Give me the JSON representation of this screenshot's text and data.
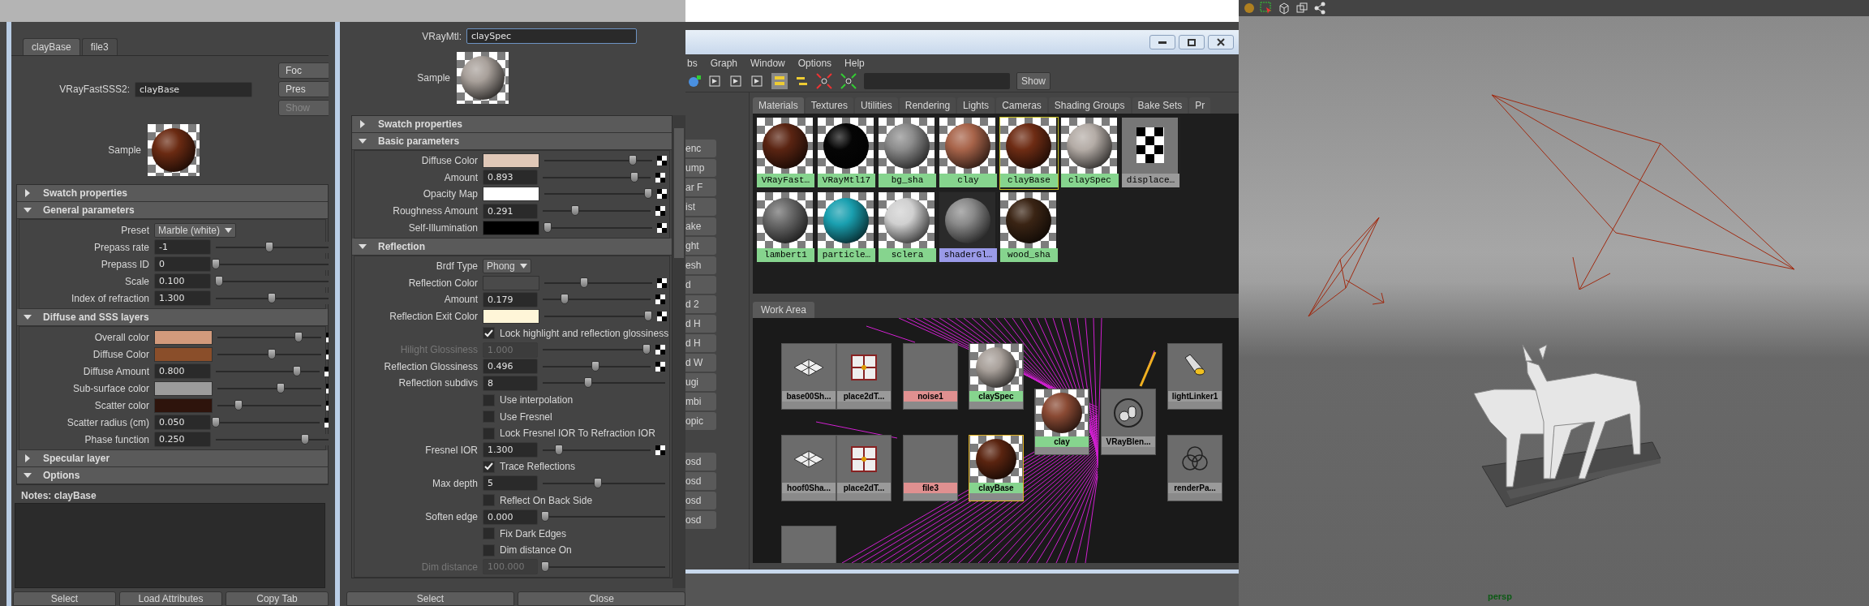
{
  "attribute_editor": {
    "tabs": [
      {
        "label": "clayBase",
        "selected": true
      },
      {
        "label": "file3",
        "selected": false
      }
    ],
    "node_type": "VRayFastSSS2:",
    "node_name": "clayBase",
    "side_buttons": [
      {
        "label": "Foc",
        "disabled": false
      },
      {
        "label": "Pres",
        "disabled": false
      },
      {
        "label": "Show",
        "disabled": true
      }
    ],
    "sample_label": "Sample",
    "sections": [
      {
        "title": "Swatch properties",
        "expanded": false
      },
      {
        "title": "General parameters",
        "expanded": true,
        "rows": [
          {
            "kind": "dropdown",
            "label": "Preset",
            "value": "Marble (white)"
          },
          {
            "kind": "number",
            "label": "Prepass rate",
            "value": "-1",
            "level": 0.45,
            "mapped": false,
            "disabled": false
          },
          {
            "kind": "number",
            "label": "Prepass ID",
            "value": "0",
            "level": 0,
            "mapped": false,
            "disabled": false
          },
          {
            "kind": "number",
            "label": "Scale",
            "value": "0.100",
            "level": 0.03,
            "mapped": false,
            "disabled": false
          },
          {
            "kind": "number",
            "label": "Index of refraction",
            "value": "1.300",
            "level": 0.47,
            "mapped": false,
            "disabled": false
          }
        ]
      },
      {
        "title": "Diffuse and SSS layers",
        "expanded": true,
        "rows": [
          {
            "kind": "color",
            "label": "Overall color",
            "color": "#d29a7c",
            "level": 0.78,
            "mapped": true
          },
          {
            "kind": "color",
            "label": "Diffuse Color",
            "color": "#8a4e2a",
            "level": 0.52,
            "mapped": true
          },
          {
            "kind": "number",
            "label": "Diffuse Amount",
            "value": "0.800",
            "level": 0.78,
            "mapped": true,
            "disabled": false
          },
          {
            "kind": "color",
            "label": "Sub-surface color",
            "color": "#9c9c9c",
            "level": 0.61,
            "mapped": true
          },
          {
            "kind": "color",
            "label": "Scatter color",
            "color": "#2e140c",
            "level": 0.2,
            "mapped": true
          },
          {
            "kind": "number",
            "label": "Scatter radius (cm)",
            "value": "0.050",
            "level": 0,
            "mapped": true,
            "disabled": false
          },
          {
            "kind": "number",
            "label": "Phase function",
            "value": "0.250",
            "level": 0.75,
            "mapped": false,
            "disabled": false
          }
        ]
      },
      {
        "title": "Specular layer",
        "expanded": false
      },
      {
        "title": "Options",
        "expanded": true
      }
    ],
    "notes": "Notes:  clayBase",
    "buttons": [
      "Select",
      "Load Attributes",
      "Copy Tab"
    ]
  },
  "material_editor": {
    "node_type": "VRayMtl:",
    "node_name": "claySpec",
    "sample_label": "Sample",
    "sections": [
      {
        "title": "Swatch properties",
        "expanded": false
      },
      {
        "title": "Basic parameters",
        "expanded": true,
        "rows": [
          {
            "kind": "color",
            "label": "Diffuse Color",
            "color": "#e0c8b8",
            "level": 0.82,
            "mapped": true
          },
          {
            "kind": "number",
            "label": "Amount",
            "value": "0.893",
            "level": 0.85,
            "mapped": true,
            "disabled": false
          },
          {
            "kind": "color",
            "label": "Opacity Map",
            "color": "#ffffff",
            "level": 0.96,
            "mapped": true
          },
          {
            "kind": "number",
            "label": "Roughness Amount",
            "value": "0.291",
            "level": 0.3,
            "mapped": true,
            "disabled": false
          },
          {
            "kind": "color",
            "label": "Self-Illumination",
            "color": "#000000",
            "level": 0.03,
            "mapped": true
          }
        ]
      },
      {
        "title": "Reflection",
        "expanded": true,
        "rows": [
          {
            "kind": "dropdown",
            "label": "Brdf Type",
            "value": "Phong"
          },
          {
            "kind": "color",
            "label": "Reflection Color",
            "color": "#4a4a4a",
            "level": 0.37,
            "mapped": true
          },
          {
            "kind": "number",
            "label": "Amount",
            "value": "0.179",
            "level": 0.2,
            "mapped": true,
            "disabled": false
          },
          {
            "kind": "color",
            "label": "Reflection Exit Color",
            "color": "#fff6d8",
            "level": 0.96,
            "mapped": true
          },
          {
            "kind": "checkbox",
            "label": "Lock highlight and reflection glossiness",
            "checked": true
          },
          {
            "kind": "number",
            "label": "Hilight Glossiness",
            "value": "1.000",
            "level": 0.96,
            "mapped": true,
            "disabled": true
          },
          {
            "kind": "number",
            "label": "Reflection Glossiness",
            "value": "0.496",
            "level": 0.49,
            "mapped": true,
            "disabled": false
          },
          {
            "kind": "number",
            "label": "Reflection subdivs",
            "value": "8",
            "level": 0.37,
            "mapped": false,
            "disabled": false
          },
          {
            "kind": "checkbox",
            "label": "Use interpolation",
            "checked": false
          },
          {
            "kind": "checkbox",
            "label": "Use Fresnel",
            "checked": false
          },
          {
            "kind": "checkbox",
            "label": "Lock Fresnel IOR To Refraction IOR",
            "checked": false
          },
          {
            "kind": "number",
            "label": "Fresnel IOR",
            "value": "1.300",
            "level": 0.15,
            "mapped": true,
            "disabled": false
          },
          {
            "kind": "checkbox",
            "label": "Trace Reflections",
            "checked": true
          },
          {
            "kind": "number",
            "label": "Max depth",
            "value": "5",
            "level": 0.45,
            "mapped": false,
            "disabled": false
          },
          {
            "kind": "checkbox",
            "label": "Reflect On Back Side",
            "checked": false
          },
          {
            "kind": "number",
            "label": "Soften edge",
            "value": "0.000",
            "level": 0.02,
            "mapped": false,
            "disabled": false
          },
          {
            "kind": "checkbox",
            "label": "Fix Dark Edges",
            "checked": false
          },
          {
            "kind": "checkbox",
            "label": "Dim distance On",
            "checked": false
          },
          {
            "kind": "number",
            "label": "Dim distance",
            "value": "100.000",
            "level": 0.02,
            "mapped": false,
            "disabled": true
          }
        ]
      }
    ],
    "buttons": [
      "Select",
      "Close"
    ]
  },
  "hypershade": {
    "menu": [
      "bs",
      "Graph",
      "Window",
      "Options",
      "Help"
    ],
    "show_button": "Show",
    "side_list": [
      "enc",
      "ump",
      "ar F",
      "ist",
      "ake",
      "ght",
      "esh",
      "d",
      "d 2",
      "d H",
      "d H",
      "d W",
      "ugi",
      "mbi",
      "opic",
      "osd",
      "osd",
      "osd",
      "osd"
    ],
    "tabs": [
      {
        "label": "Materials",
        "selected": true
      },
      {
        "label": "Textures",
        "selected": false
      },
      {
        "label": "Utilities",
        "selected": false
      },
      {
        "label": "Rendering",
        "selected": false
      },
      {
        "label": "Lights",
        "selected": false
      },
      {
        "label": "Cameras",
        "selected": false
      },
      {
        "label": "Shading Groups",
        "selected": false
      },
      {
        "label": "Bake Sets",
        "selected": false
      },
      {
        "label": "Pr",
        "selected": false
      }
    ],
    "materials": [
      {
        "name": "VRayFast…",
        "kind": "material",
        "color": "#5a2412",
        "selected": false
      },
      {
        "name": "VRayMtl17",
        "kind": "material",
        "color": "#050505",
        "selected": false
      },
      {
        "name": "bg_sha",
        "kind": "material",
        "color": "#8c8c8c",
        "selected": false
      },
      {
        "name": "clay",
        "kind": "material",
        "color": "#a8644a",
        "selected": false
      },
      {
        "name": "clayBase",
        "kind": "material",
        "color": "#6e2c14",
        "selected": true
      },
      {
        "name": "claySpec",
        "kind": "material",
        "color": "#b4aca6",
        "selected": false
      },
      {
        "name": "displace…",
        "kind": "texture",
        "color": "#000000",
        "selected": false
      },
      {
        "name": "lambert1",
        "kind": "material",
        "color": "#6a6a6a",
        "selected": false
      },
      {
        "name": "particle…",
        "kind": "material",
        "color": "#1aa0b0",
        "selected": false
      },
      {
        "name": "sclera",
        "kind": "material",
        "color": "#d0d0d0",
        "selected": false
      },
      {
        "name": "shaderGl…",
        "kind": "glow",
        "color": "#8a8a8a",
        "selected": false
      },
      {
        "name": "wood_sha",
        "kind": "material",
        "color": "#3a2414",
        "selected": false
      }
    ],
    "work_area_tab": "Work Area",
    "nodes": [
      {
        "name": "base00Sh...",
        "kind": "geometry",
        "selected": false
      },
      {
        "name": "place2dT...",
        "kind": "placement",
        "selected": false
      },
      {
        "name": "noise1",
        "kind": "texture",
        "selected": false
      },
      {
        "name": "claySpec",
        "kind": "material",
        "selected": false
      },
      {
        "name": "clay",
        "kind": "material",
        "selected": false
      },
      {
        "name": "VRayBlen...",
        "kind": "blend",
        "selected": false
      },
      {
        "name": "lightLinker1",
        "kind": "light_linker",
        "selected": false
      },
      {
        "name": "hoof0Sha...",
        "kind": "geometry",
        "selected": false
      },
      {
        "name": "place2dT...",
        "kind": "placement",
        "selected": false
      },
      {
        "name": "file3",
        "kind": "texture",
        "selected": false
      },
      {
        "name": "clayBase",
        "kind": "material",
        "selected": true
      },
      {
        "name": "renderPa...",
        "kind": "partition",
        "selected": false
      }
    ]
  },
  "viewport": {
    "camera_label": "persp"
  }
}
